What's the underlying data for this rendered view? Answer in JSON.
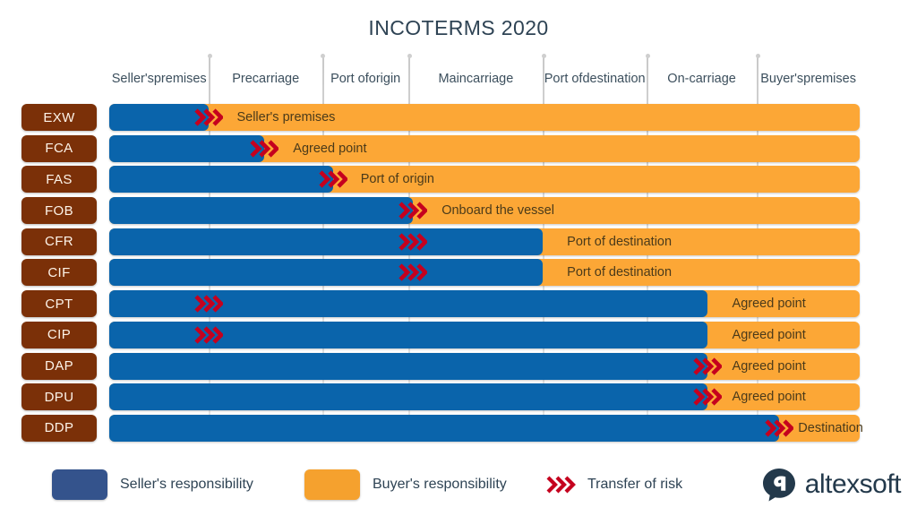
{
  "title": "INCOTERMS 2020",
  "colors": {
    "seller_bar": "#0A64AB",
    "buyer_bar": "#FCA736",
    "term_chip": "#7B3008",
    "risk_arrow": "#C5001E",
    "legend_seller": "#34538C",
    "legend_buyer": "#F5A12E",
    "title_text": "#2E4354"
  },
  "columns": [
    {
      "label": "Seller's premises",
      "line1": "Seller's",
      "line2": "premises"
    },
    {
      "label": "Precarriage",
      "line1": "Precarriage",
      "line2": ""
    },
    {
      "label": "Port of origin",
      "line1": "Port of",
      "line2": "origin"
    },
    {
      "label": "Main carriage",
      "line1": "Main",
      "line2": "carriage"
    },
    {
      "label": "Port of destination",
      "line1": "Port of",
      "line2": "destination"
    },
    {
      "label": "On-carriage",
      "line1": "On-carriage",
      "line2": ""
    },
    {
      "label": "Buyer's premises",
      "line1": "Buyer's",
      "line2": "premises"
    }
  ],
  "rows": [
    {
      "term": "EXW",
      "seller_pct": 13.3,
      "risk_pct": 13.3,
      "note": "Seller's premises",
      "note_pct": 17.0
    },
    {
      "term": "FCA",
      "seller_pct": 20.6,
      "risk_pct": 20.6,
      "note": "Agreed point",
      "note_pct": 24.5
    },
    {
      "term": "FAS",
      "seller_pct": 29.8,
      "risk_pct": 29.8,
      "note": "Port of origin",
      "note_pct": 33.5
    },
    {
      "term": "FOB",
      "seller_pct": 40.5,
      "risk_pct": 40.5,
      "note": "Onboard the vessel",
      "note_pct": 44.3
    },
    {
      "term": "CFR",
      "seller_pct": 57.8,
      "risk_pct": 40.5,
      "note": "Port of destination",
      "note_pct": 61.0
    },
    {
      "term": "CIF",
      "seller_pct": 57.8,
      "risk_pct": 40.5,
      "note": "Port of destination",
      "note_pct": 61.0
    },
    {
      "term": "CPT",
      "seller_pct": 79.7,
      "risk_pct": 13.3,
      "note": "Agreed point",
      "note_pct": 83.0
    },
    {
      "term": "CIP",
      "seller_pct": 79.7,
      "risk_pct": 13.3,
      "note": "Agreed point",
      "note_pct": 83.0
    },
    {
      "term": "DAP",
      "seller_pct": 79.7,
      "risk_pct": 79.7,
      "note": "Agreed point",
      "note_pct": 83.0
    },
    {
      "term": "DPU",
      "seller_pct": 79.7,
      "risk_pct": 79.7,
      "note": "Agreed point",
      "note_pct": 83.0
    },
    {
      "term": "DDP",
      "seller_pct": 89.3,
      "risk_pct": 89.3,
      "note": "Destination",
      "note_pct": 91.8
    }
  ],
  "gridlines_pct": [
    13.3,
    28.4,
    39.9,
    57.8,
    71.6,
    86.3
  ],
  "legend": {
    "seller": "Seller's responsibility",
    "buyer": "Buyer's responsibility",
    "risk": "Transfer of risk"
  },
  "brand": {
    "name": "altexsoft"
  }
}
